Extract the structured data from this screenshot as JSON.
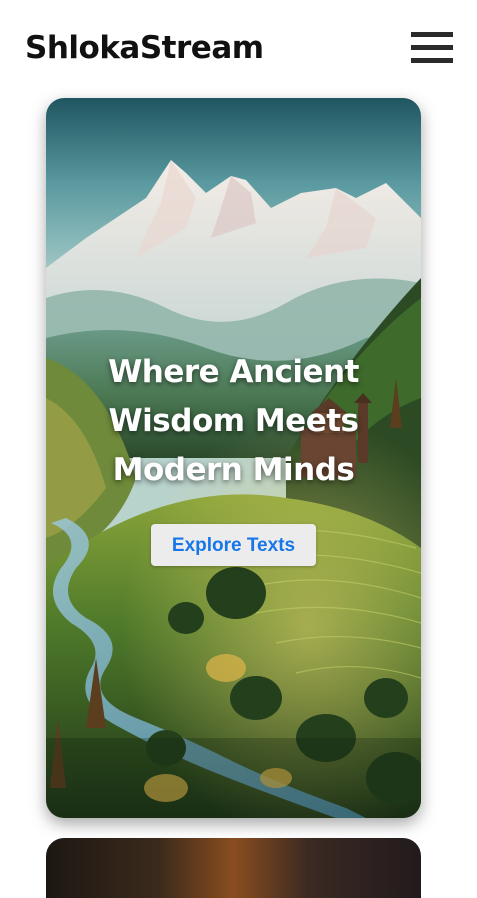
{
  "header": {
    "brand": "ShlokaStream",
    "menu_icon": "hamburger-menu-icon"
  },
  "hero": {
    "title_lines": [
      "Where Ancient",
      "Wisdom Meets",
      "Modern Minds"
    ],
    "cta_label": "Explore Texts",
    "cta_color": "#1877e8"
  },
  "colors": {
    "background": "#ffffff",
    "brand_text": "#111111",
    "button_bg": "#ececec"
  }
}
